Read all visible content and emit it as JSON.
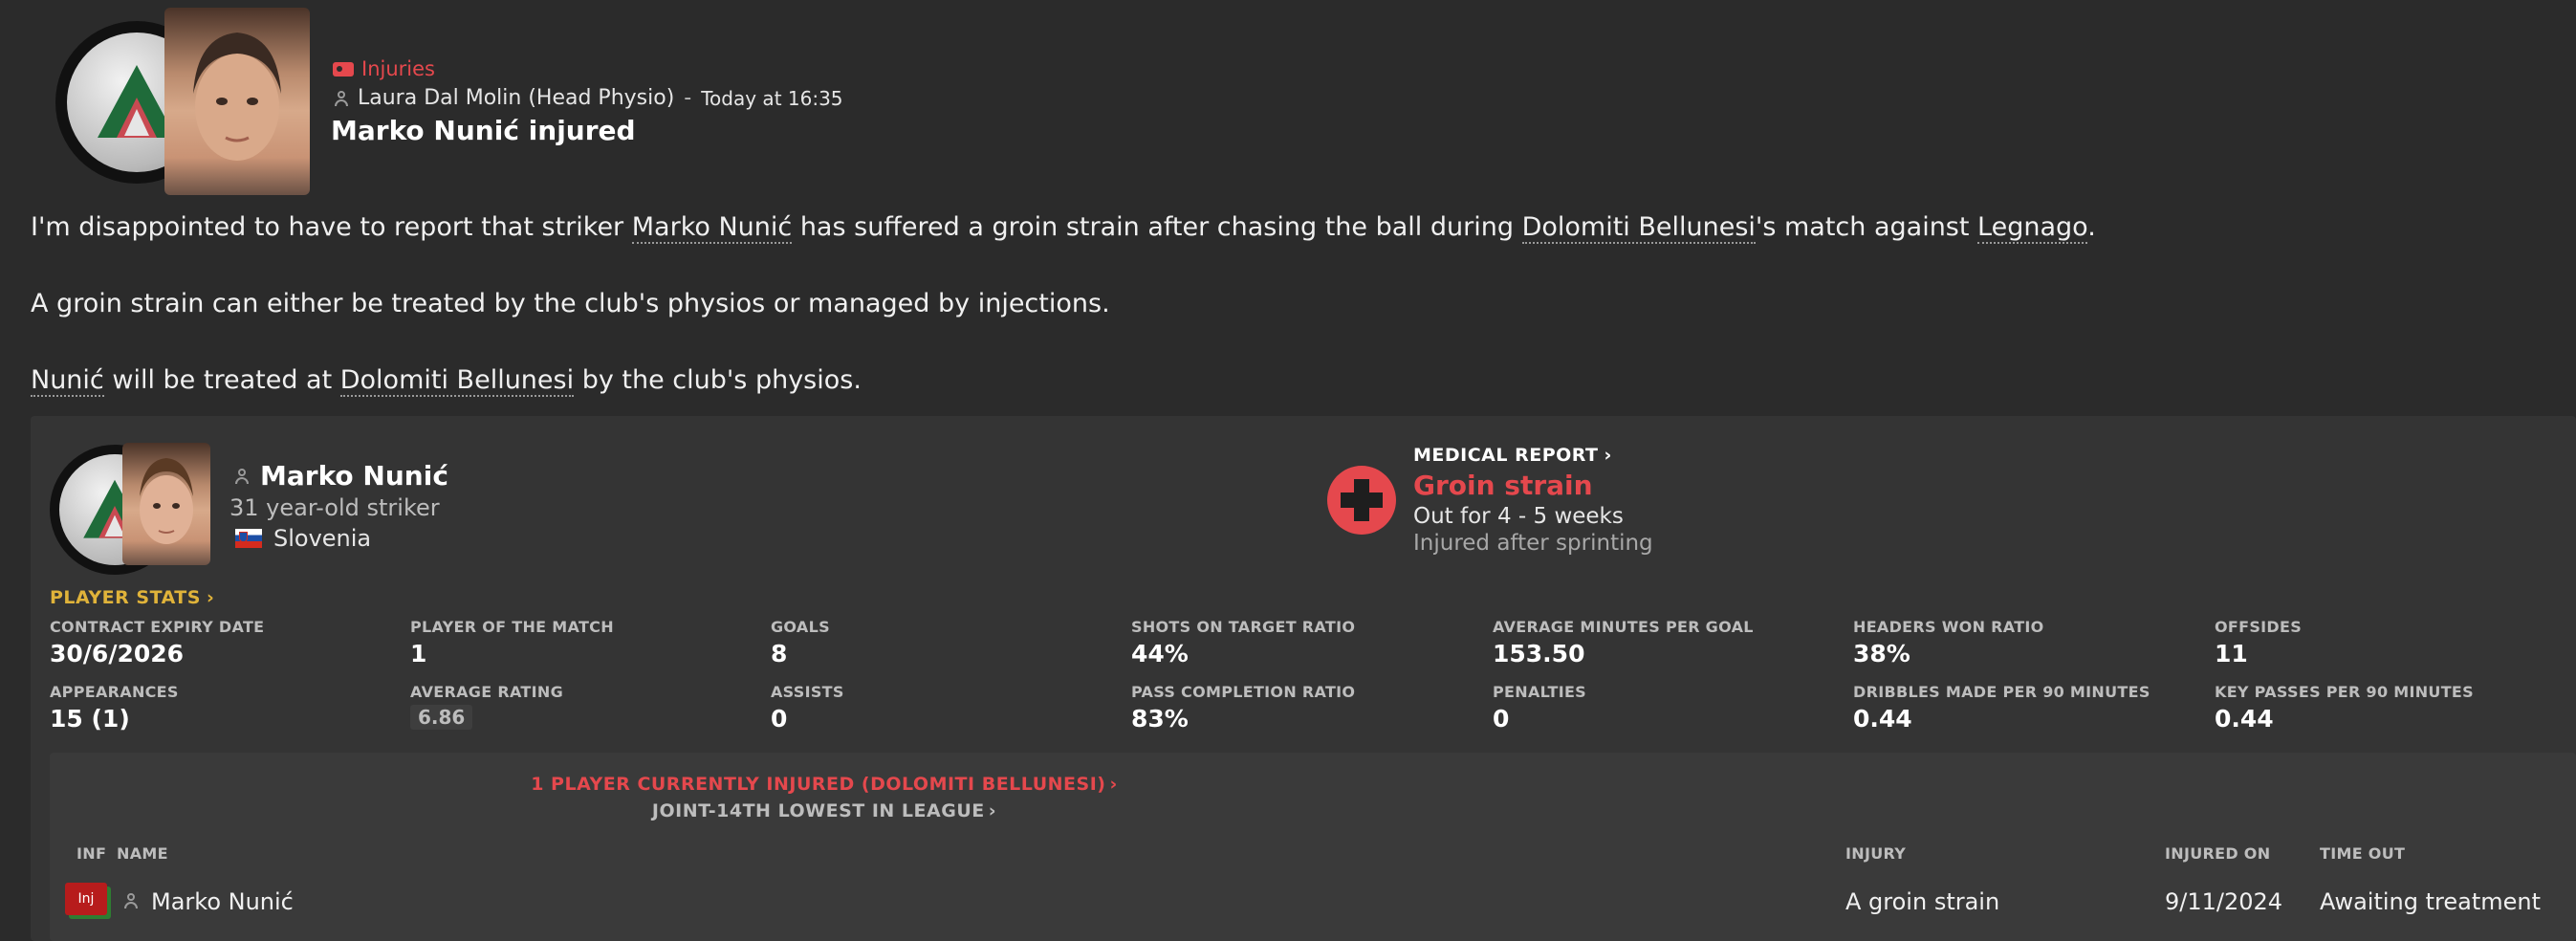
{
  "header": {
    "category": "Injuries",
    "author": "Laura Dal Molin (Head Physio)",
    "separator": "-",
    "time": "Today at 16:35",
    "title": "Marko Nunić injured"
  },
  "body": {
    "p1": {
      "t1": "I'm disappointed to have to report that striker ",
      "link_player": "Marko Nunić",
      "t2": " has suffered a groin strain after chasing the ball during ",
      "link_club": "Dolomiti Bellunesi",
      "t3": "'s match against ",
      "link_opponent": "Legnago",
      "t4": "."
    },
    "p2": "A groin strain can either be treated by the club's physios or managed by injections.",
    "p3": {
      "link_player": "Nunić",
      "t1": " will be treated at ",
      "link_club": "Dolomiti Bellunesi",
      "t2": " by the club's physios."
    }
  },
  "player_card": {
    "name": "Marko Nunić",
    "description": "31 year-old striker",
    "nationality": "Slovenia",
    "medical": {
      "heading": "MEDICAL REPORT",
      "injury": "Groin strain",
      "duration": "Out for 4 - 5 weeks",
      "cause": "Injured after sprinting"
    },
    "stats_link": "PLAYER STATS",
    "stats": [
      {
        "label": "CONTRACT EXPIRY DATE",
        "value": "30/6/2026"
      },
      {
        "label": "PLAYER OF THE MATCH",
        "value": "1"
      },
      {
        "label": "GOALS",
        "value": "8"
      },
      {
        "label": "SHOTS ON TARGET RATIO",
        "value": "44%"
      },
      {
        "label": "AVERAGE MINUTES PER GOAL",
        "value": "153.50"
      },
      {
        "label": "HEADERS WON RATIO",
        "value": "38%"
      },
      {
        "label": "OFFSIDES",
        "value": "11"
      },
      {
        "label": "APPEARANCES",
        "value": "15 (1)"
      },
      {
        "label": "AVERAGE RATING",
        "value": "6.86"
      },
      {
        "label": "ASSISTS",
        "value": "0"
      },
      {
        "label": "PASS COMPLETION RATIO",
        "value": "83%"
      },
      {
        "label": "PENALTIES",
        "value": "0"
      },
      {
        "label": "DRIBBLES MADE PER 90 MINUTES",
        "value": "0.44"
      },
      {
        "label": "KEY PASSES PER 90 MINUTES",
        "value": "0.44"
      }
    ]
  },
  "injury_table": {
    "headline": "1 PLAYER CURRENTLY INJURED (DOLOMITI BELLUNESI)",
    "subline": "JOINT-14TH LOWEST IN LEAGUE",
    "columns": {
      "inf": "INF",
      "name": "NAME",
      "injury": "INJURY",
      "injured_on": "INJURED ON",
      "time_out": "TIME OUT"
    },
    "rows": [
      {
        "inf": "Inj",
        "name": "Marko Nunić",
        "injury": "A groin strain",
        "injured_on": "9/11/2024",
        "time_out": "Awaiting treatment"
      }
    ]
  },
  "colors": {
    "accent_red": "#e5484d",
    "accent_gold": "#e0b33a",
    "background": "#2b2b2b",
    "card": "#343434"
  },
  "icons": [
    "tag-icon",
    "person-icon",
    "medical-cross-icon",
    "chevron-right-icon",
    "slovenia-flag-icon"
  ]
}
